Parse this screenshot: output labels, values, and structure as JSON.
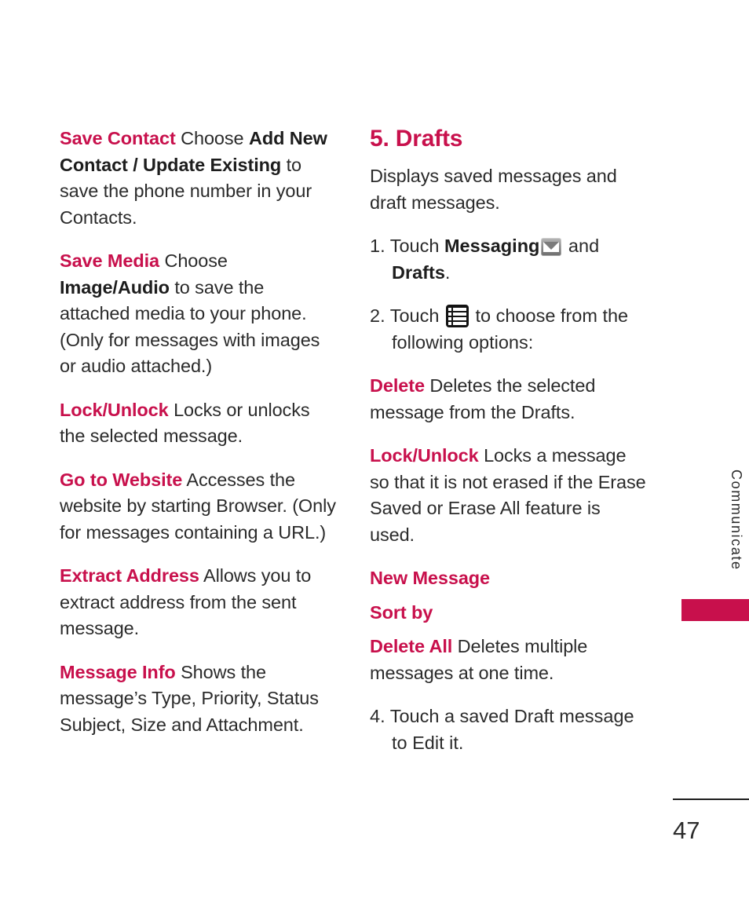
{
  "document": {
    "page_number": "47",
    "side_tab_label": "Communicate",
    "accent_color": "#c8104c",
    "text_color": "#2b2b2b"
  },
  "left_column": {
    "entries": [
      {
        "term": "Save Contact",
        "body_1": " Choose ",
        "bold_1": "Add New Contact / Update Existing",
        "body_2": " to save the phone number in your Contacts."
      },
      {
        "term": "Save Media",
        "body_1": " Choose ",
        "bold_1": "Image/Audio",
        "body_2": " to save the attached media to your phone. (Only for messages with images or audio attached.)"
      },
      {
        "term": "Lock/Unlock",
        "body_1": " Locks or unlocks the selected message."
      },
      {
        "term": "Go to Website",
        "body_1": " Accesses the website by starting Browser. (Only for messages containing a URL.)"
      },
      {
        "term": "Extract Address",
        "body_1": "  Allows you to extract address from the sent message."
      },
      {
        "term": "Message Info",
        "body_1": " Shows the message’s Type, Priority, Status Subject, Size and Attachment."
      }
    ]
  },
  "right_column": {
    "heading": "5. Drafts",
    "intro": "Displays saved messages and draft messages.",
    "step_1": {
      "number": "1.",
      "text_before": " Touch ",
      "bold_1": "Messaging",
      "icon": "envelope-icon",
      "text_middle": " and ",
      "bold_2": "Drafts",
      "text_after": "."
    },
    "step_2": {
      "number": "2.",
      "text_before": " Touch ",
      "icon": "list-menu-icon",
      "text_after": " to choose from the following options:"
    },
    "options": [
      {
        "term": "Delete",
        "body": " Deletes the selected message from the Drafts."
      },
      {
        "term": "Lock/Unlock",
        "body": " Locks a message so that it is not erased if the Erase Saved or Erase All feature is used."
      },
      {
        "term": "New Message",
        "body": ""
      },
      {
        "term": "Sort by",
        "body": ""
      },
      {
        "term": "Delete All",
        "body": " Deletes multiple messages at one time."
      }
    ],
    "step_4": {
      "number": "4.",
      "text": " Touch a saved Draft message to Edit it."
    }
  }
}
